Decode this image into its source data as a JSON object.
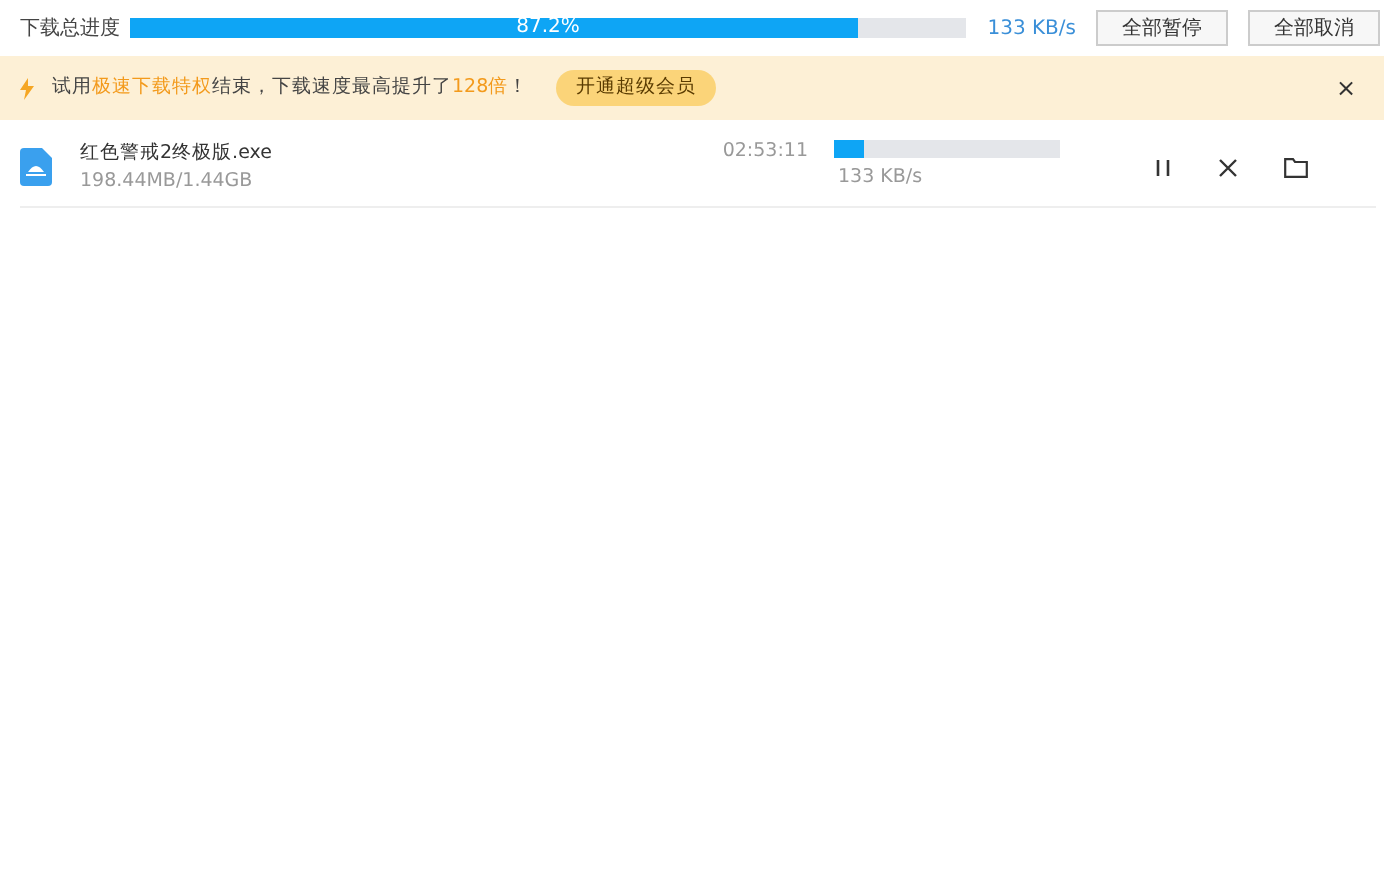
{
  "overall": {
    "label": "下载总进度",
    "level": 0.872,
    "percent": "87.2%",
    "speed": "133 KB/s",
    "buttons": [
      "全部暂停",
      "全部取消"
    ]
  },
  "banner": {
    "segments": [
      {
        "text": "试用",
        "highlight": false
      },
      {
        "text": "极速下载特权",
        "highlight": true
      },
      {
        "text": "结束，下载速度最高提升了",
        "highlight": false
      },
      {
        "text": "128倍",
        "highlight": true
      },
      {
        "text": "！",
        "highlight": false
      }
    ],
    "button": "开通超级会员",
    "close": "×"
  },
  "tasks": [
    {
      "name": "红色警戒2终极版.exe",
      "size": "198.44MB/1.44GB",
      "remaining": "02:53:11",
      "level": 0.13,
      "speed": "133 KB/s"
    }
  ]
}
